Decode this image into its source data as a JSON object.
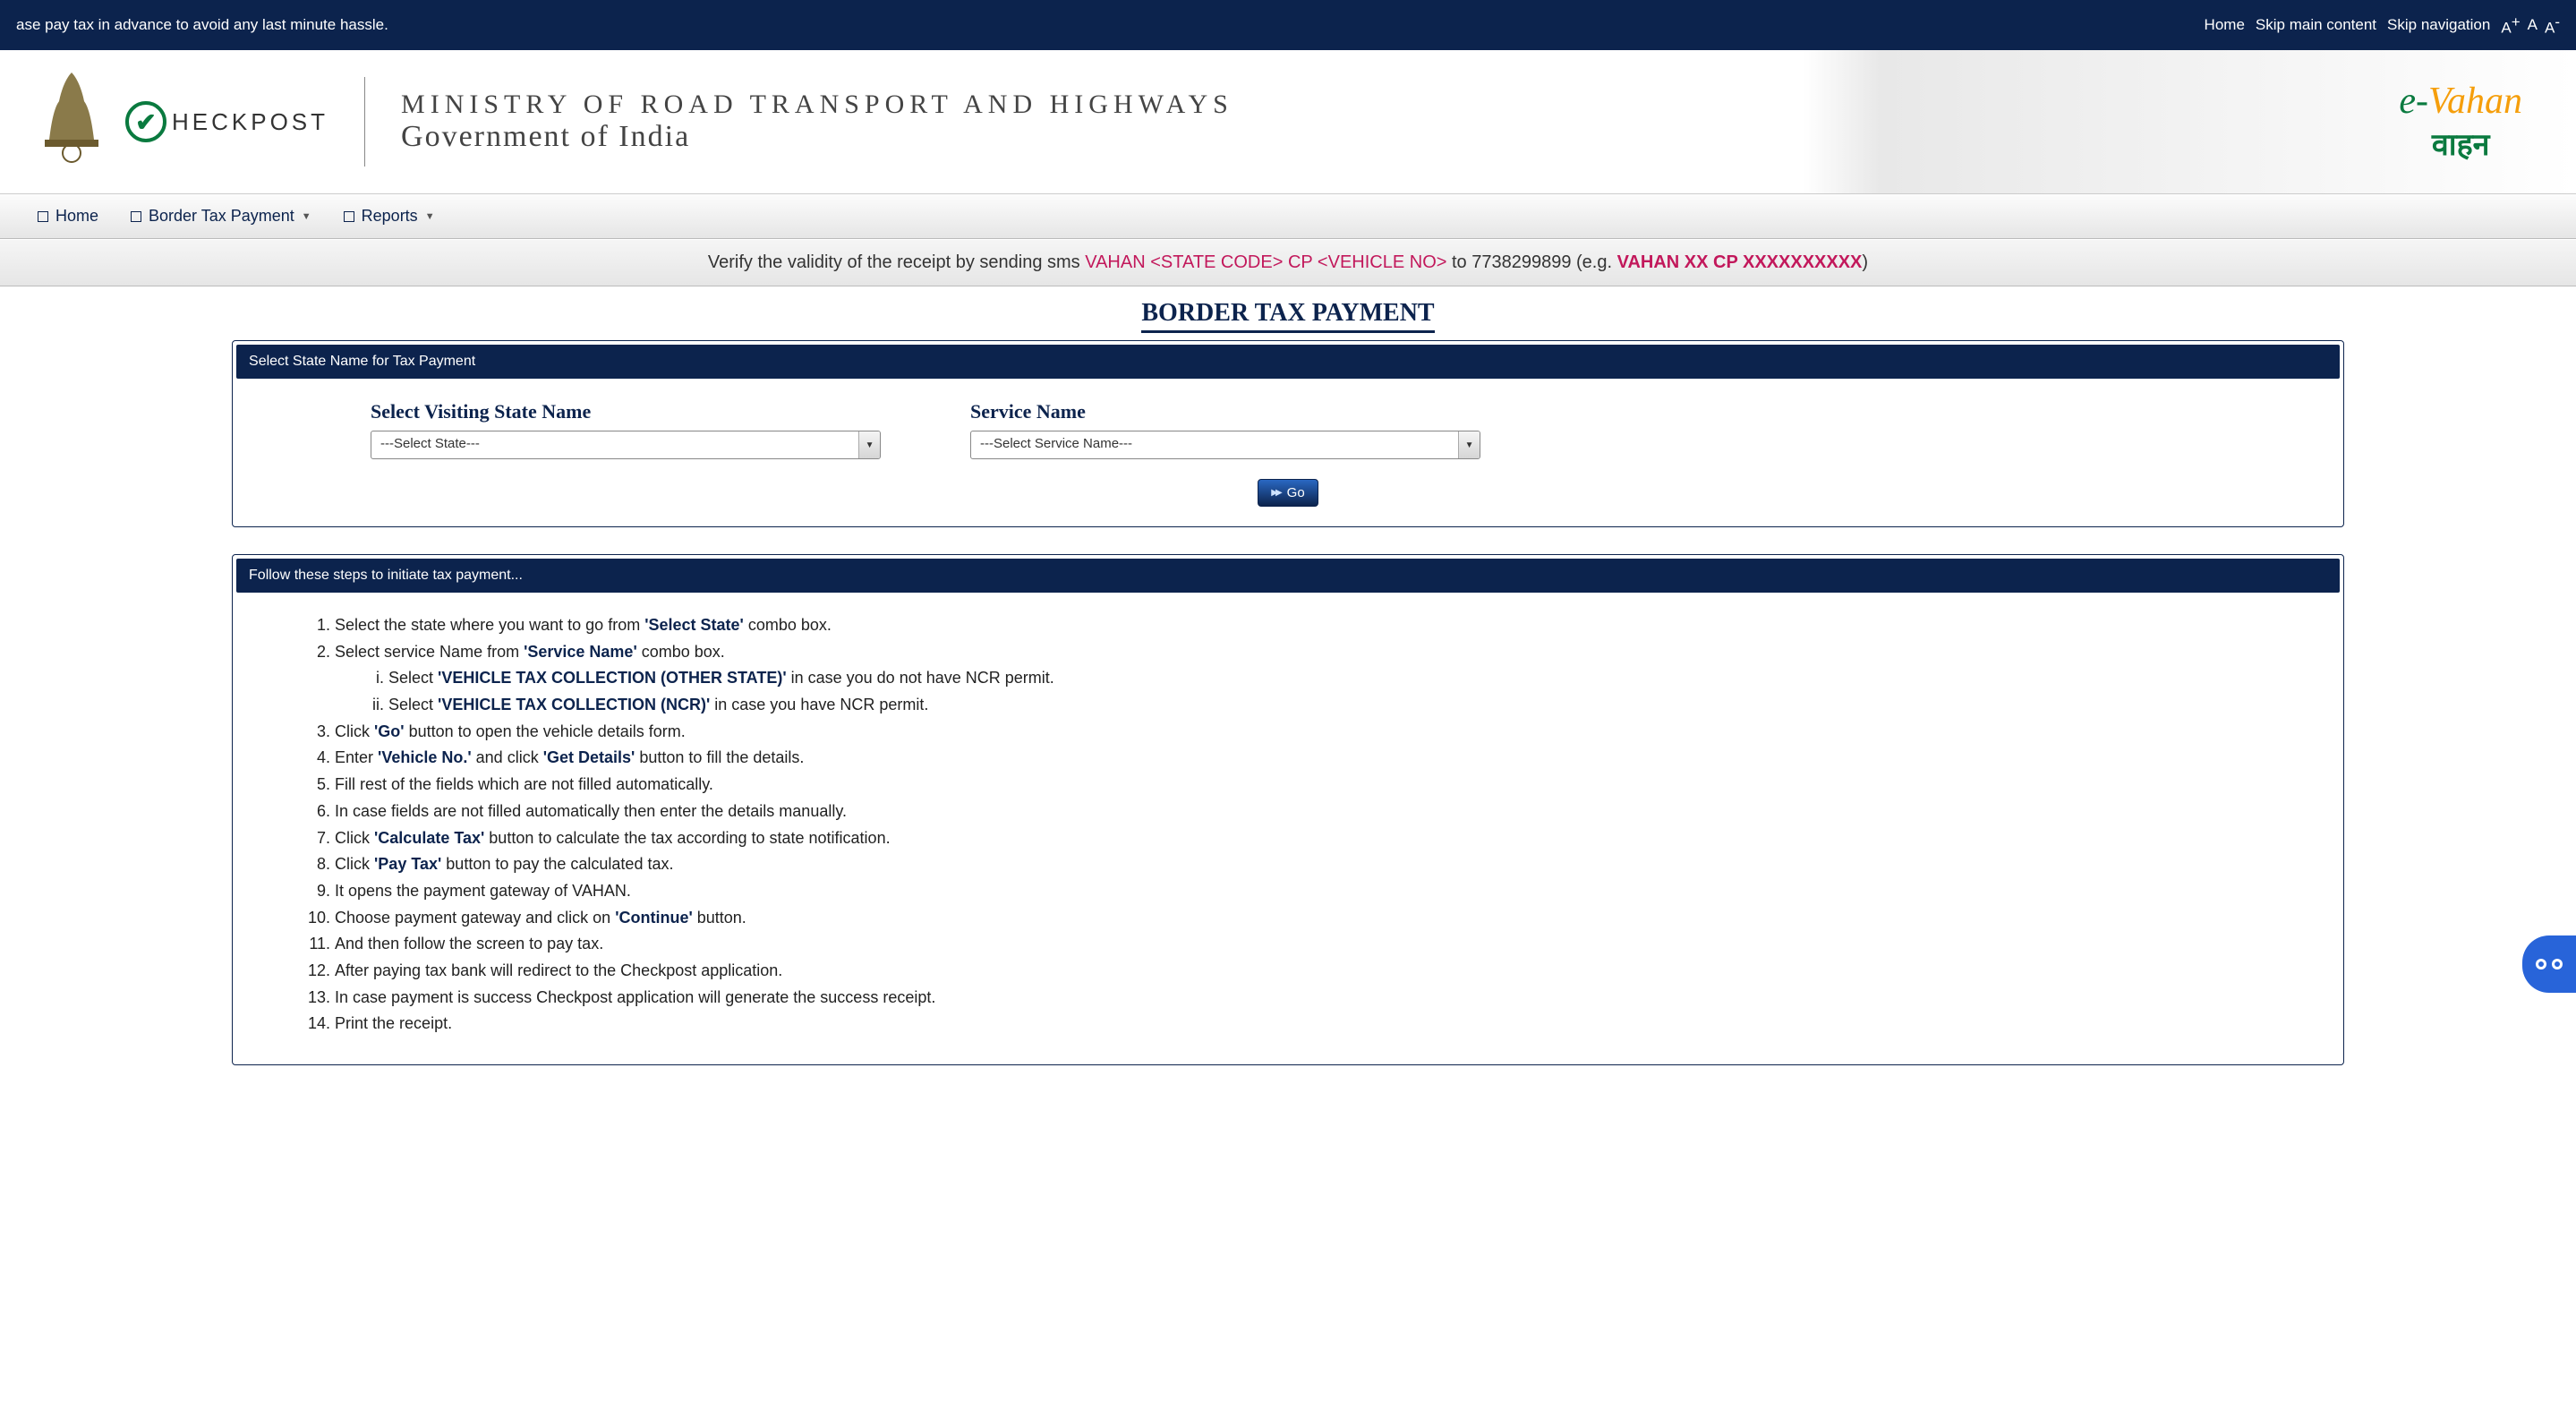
{
  "topbar": {
    "marquee": "ase pay tax in advance to avoid any last minute hassle.",
    "links": {
      "home": "Home",
      "skip_main": "Skip main content",
      "skip_nav": "Skip navigation"
    },
    "font": {
      "inc": "A",
      "inc_sup": "+",
      "normal": "A",
      "dec": "A",
      "dec_sup": "-"
    }
  },
  "banner": {
    "checkpost": "HECKPOST",
    "ministry_line1": "MINISTRY OF ROAD TRANSPORT AND HIGHWAYS",
    "ministry_line2": "Government of India",
    "evahan_prefix": "e-",
    "evahan_text": "Vahan",
    "evahan_hindi": "वाहन"
  },
  "nav": {
    "home": "Home",
    "border_tax": "Border Tax Payment",
    "reports": "Reports"
  },
  "verify": {
    "pre": "Verify the validity of the receipt by sending sms ",
    "code1": "VAHAN <STATE CODE> CP <VEHICLE NO>",
    "mid": " to 7738299899 (e.g. ",
    "code2": "VAHAN XX CP XXXXXXXXXX",
    "post": ")"
  },
  "page_title": "BORDER TAX PAYMENT",
  "form_panel": {
    "header": "Select State Name for Tax Payment",
    "state_label": "Select Visiting State Name",
    "state_value": "---Select State---",
    "service_label": "Service Name",
    "service_value": "---Select Service Name---",
    "go": "Go"
  },
  "steps_panel": {
    "header": "Follow these steps to initiate tax payment...",
    "s1_a": "Select the state where you want to go from ",
    "s1_b": "'Select State'",
    "s1_c": " combo box.",
    "s2_a": "Select service Name from ",
    "s2_b": "'Service Name'",
    "s2_c": " combo box.",
    "s2i_a": "Select ",
    "s2i_b": "'VEHICLE TAX COLLECTION (OTHER STATE)'",
    "s2i_c": " in case you do not have NCR permit.",
    "s2ii_a": "Select ",
    "s2ii_b": "'VEHICLE TAX COLLECTION (NCR)'",
    "s2ii_c": " in case you have NCR permit.",
    "s3_a": "Click ",
    "s3_b": "'Go'",
    "s3_c": " button to open the vehicle details form.",
    "s4_a": "Enter ",
    "s4_b": "'Vehicle No.'",
    "s4_c": " and click ",
    "s4_d": "'Get Details'",
    "s4_e": " button to fill the details.",
    "s5": "Fill rest of the fields which are not filled automatically.",
    "s6": "In case fields are not filled automatically then enter the details manually.",
    "s7_a": "Click ",
    "s7_b": "'Calculate Tax'",
    "s7_c": " button to calculate the tax according to state notification.",
    "s8_a": "Click ",
    "s8_b": "'Pay Tax'",
    "s8_c": " button to pay the calculated tax.",
    "s9": "It opens the payment gateway of VAHAN.",
    "s10_a": "Choose payment gateway and click on ",
    "s10_b": "'Continue'",
    "s10_c": " button.",
    "s11": "And then follow the screen to pay tax.",
    "s12": "After paying tax bank will redirect to the Checkpost application.",
    "s13": "In case payment is success Checkpost application will generate the success receipt.",
    "s14": "Print the receipt."
  }
}
